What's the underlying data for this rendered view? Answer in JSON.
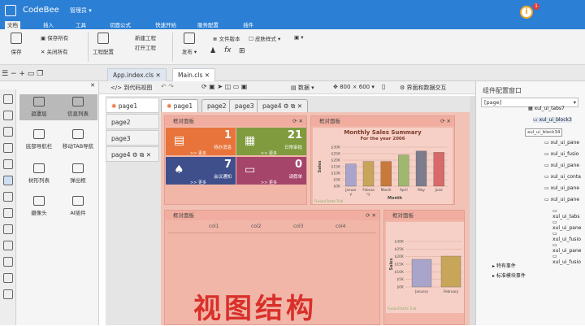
{
  "app": {
    "name": "CodeBee",
    "user": "管理员",
    "notify_count": "1"
  },
  "menu": [
    "文档",
    "插入",
    "工具",
    "切面公式",
    "快速开始",
    "服务配置",
    "插件"
  ],
  "ribbon": {
    "save": "保存",
    "save_all": "保存所有",
    "close_all": "关闭所有",
    "project_config": "工程配置",
    "new_project": "新建工程",
    "open_project": "打开工程",
    "publish": "发布",
    "file_version": "文件版本",
    "skin_style": "皮肤样式"
  },
  "doc_tabs": [
    "App.index.cls",
    "Main.cls"
  ],
  "left": {
    "components": [
      {
        "label": "遮罩层"
      },
      {
        "label": "信息列表"
      },
      {
        "label": "底部导航栏"
      },
      {
        "label": "移动TAB导航"
      },
      {
        "label": "树形列表"
      },
      {
        "label": "弹出框"
      },
      {
        "label": "摄像头"
      },
      {
        "label": "AI插件"
      }
    ]
  },
  "center_toolbar": {
    "code_view": "到代码视图",
    "data": "数据",
    "resolution": "800 × 600",
    "interface_data": "界面和数据交互"
  },
  "pages": [
    "page1",
    "page2",
    "page3",
    "page4"
  ],
  "page_tabs": [
    "page1",
    "page2",
    "page3",
    "page4"
  ],
  "panel_title": "框对面板",
  "tiles": [
    {
      "num": "1",
      "lbl": "待办消息",
      "color": "#e8743b"
    },
    {
      "num": "21",
      "lbl": "日常审批",
      "color": "#7f9b3e"
    },
    {
      "num": "7",
      "lbl": "会议通知",
      "color": "#3f4f8c"
    },
    {
      "num": "0",
      "lbl": "请假单",
      "color": "#a5456a"
    }
  ],
  "tile_more": ">> 更多",
  "chart_data": {
    "type": "bar",
    "title": "Monthly Sales Summary",
    "subtitle": "For the year 2006",
    "categories": [
      "Januar y",
      "Februa ry",
      "March",
      "April",
      "May",
      "June"
    ],
    "values": [
      17000,
      19000,
      19000,
      24000,
      27000,
      26000
    ],
    "colors": [
      "#a9a4c9",
      "#c7a65a",
      "#c77a3a",
      "#9fb76f",
      "#7c7c8c",
      "#d76a6a"
    ],
    "xlabel": "Month",
    "ylabel": "Sales",
    "yticks": [
      "$0K",
      "$5K",
      "$10K",
      "$15K",
      "$20K",
      "$25K",
      "$30K"
    ],
    "ylim": [
      0,
      30000
    ],
    "credit": "FusionCharts Trial"
  },
  "chart2": {
    "yticks": [
      "$0K",
      "$5K",
      "$10K",
      "$15K",
      "$20K",
      "$25K",
      "$30K"
    ],
    "categories": [
      "January",
      "February"
    ],
    "ylabel": "Sales",
    "credit": "FusionCharts Trial"
  },
  "table_cols": [
    "col1",
    "col2",
    "col3",
    "col4"
  ],
  "watermark": "视图结构",
  "right": {
    "title": "组件配置窗口",
    "root": "[page]",
    "tooltip": "xul_ui_block34",
    "tree": [
      "xul_ui_tabs7",
      "xul_ui_block3",
      "xul_ui_fillLa",
      "xul_ui_pane",
      "xul_ui_fusio",
      "xul_ui_pane",
      "xul_ui_conta",
      "xul_ui_pane",
      "xul_ui_pane",
      "xul_ui_tabs",
      "xul_ui_pane",
      "xul_ui_fusio"
    ],
    "events": [
      "特有事件",
      "标准模块事件"
    ]
  }
}
